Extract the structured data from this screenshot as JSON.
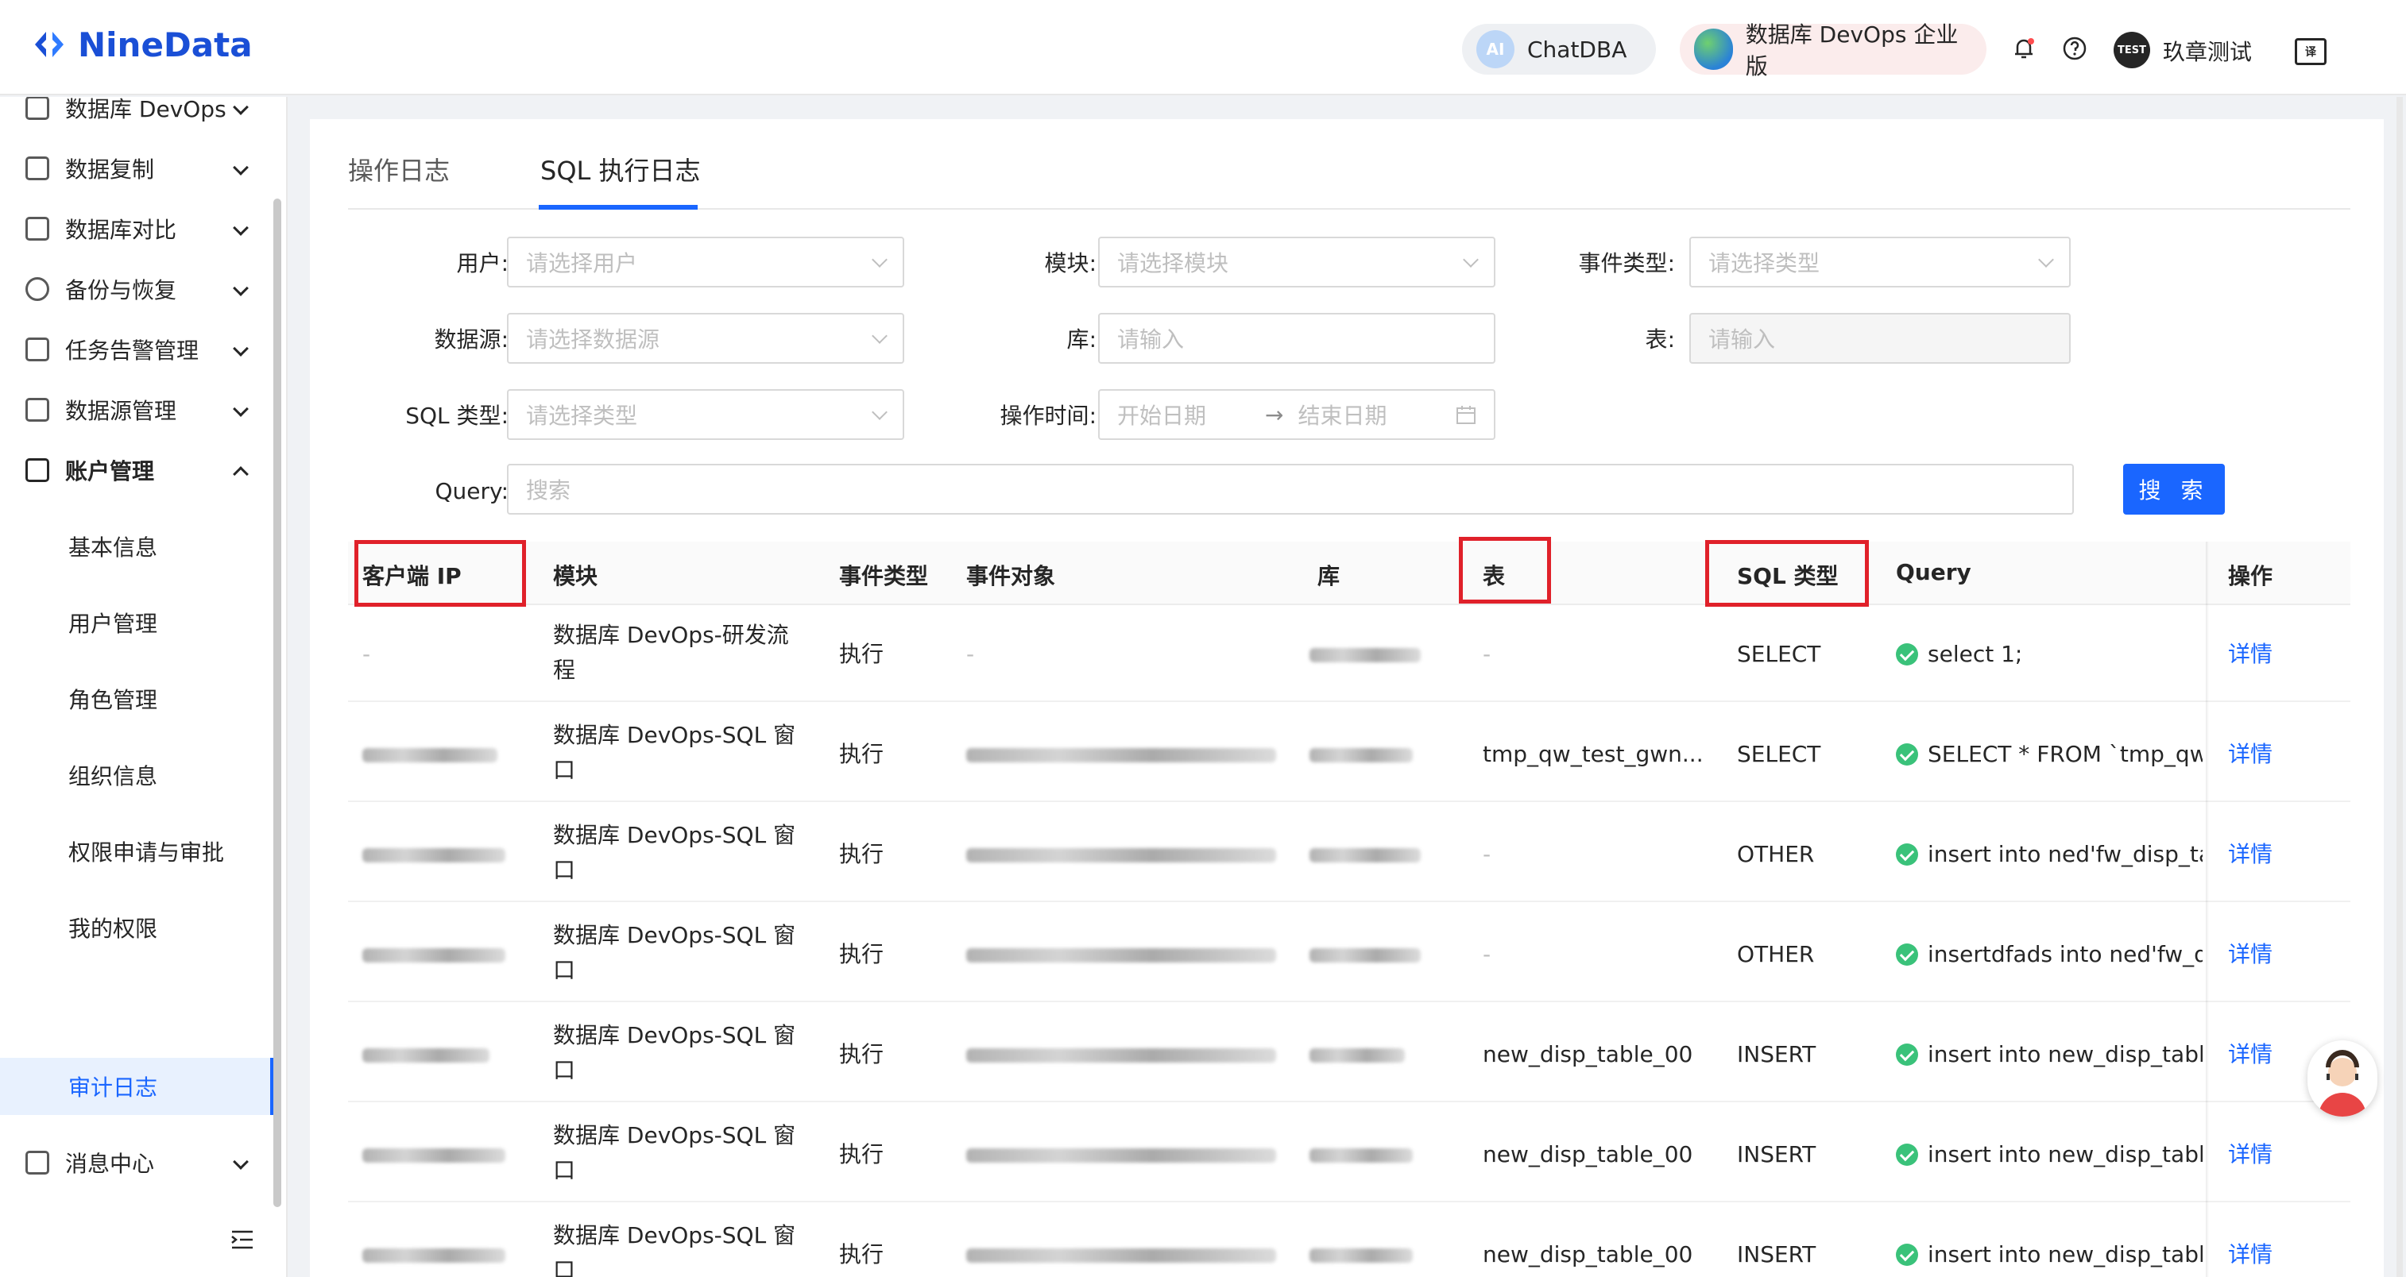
{
  "header": {
    "logo": "NineData",
    "chatdba": {
      "badge": "AI",
      "label": "ChatDBA"
    },
    "edition": "数据库 DevOps 企业版",
    "avatar_text": "TEST",
    "username": "玖章测试",
    "lang_icon": "译"
  },
  "sidebar": {
    "items": [
      {
        "label": "数据库 DevOps",
        "icon": "monitor-icon"
      },
      {
        "label": "数据复制",
        "icon": "replication-icon"
      },
      {
        "label": "数据库对比",
        "icon": "compare-icon"
      },
      {
        "label": "备份与恢复",
        "icon": "cloud-icon"
      },
      {
        "label": "任务告警管理",
        "icon": "alarm-icon"
      },
      {
        "label": "数据源管理",
        "icon": "datasource-icon"
      },
      {
        "label": "账户管理",
        "icon": "account-icon"
      },
      {
        "label": "消息中心",
        "icon": "mail-icon"
      }
    ],
    "subitems": [
      "基本信息",
      "用户管理",
      "角色管理",
      "组织信息",
      "权限申请与审批",
      "我的权限",
      "审计日志"
    ],
    "active": "审计日志"
  },
  "tabs": [
    "操作日志",
    "SQL 执行日志"
  ],
  "filters": {
    "user": {
      "label": "用户",
      "placeholder": "请选择用户"
    },
    "module": {
      "label": "模块",
      "placeholder": "请选择模块"
    },
    "event_type": {
      "label": "事件类型",
      "placeholder": "请选择类型"
    },
    "datasource": {
      "label": "数据源",
      "placeholder": "请选择数据源"
    },
    "db": {
      "label": "库",
      "placeholder": "请输入"
    },
    "table": {
      "label": "表",
      "placeholder": "请输入"
    },
    "sql_type": {
      "label": "SQL 类型",
      "placeholder": "请选择类型"
    },
    "op_time": {
      "label": "操作时间",
      "start": "开始日期",
      "end": "结束日期",
      "sep": "→"
    },
    "query": {
      "label": "Query",
      "placeholder": "搜索"
    },
    "search_button": "搜 索"
  },
  "table": {
    "columns": [
      "客户端 IP",
      "模块",
      "事件类型",
      "事件对象",
      "库",
      "表",
      "SQL 类型",
      "Query",
      "操作"
    ],
    "rows": [
      {
        "ip": "-",
        "module": [
          "数据库 DevOps-研发流",
          "程"
        ],
        "event": "执行",
        "object": "-",
        "table": "-",
        "sql_type": "SELECT",
        "query": "select 1;",
        "action": "详情"
      },
      {
        "ip": "",
        "module": [
          "数据库 DevOps-SQL 窗",
          "口"
        ],
        "event": "执行",
        "object": "",
        "table": "tmp_qw_test_gwn...",
        "sql_type": "SELECT",
        "query": "SELECT * FROM `tmp_qw_",
        "action": "详情"
      },
      {
        "ip": "",
        "module": [
          "数据库 DevOps-SQL 窗",
          "口"
        ],
        "event": "执行",
        "object": "",
        "table": "-",
        "sql_type": "OTHER",
        "query": "insert into ned'fw_disp_tab",
        "action": "详情"
      },
      {
        "ip": "",
        "module": [
          "数据库 DevOps-SQL 窗",
          "口"
        ],
        "event": "执行",
        "object": "",
        "table": "-",
        "sql_type": "OTHER",
        "query": "insertdfads into ned'fw_dis",
        "action": "详情"
      },
      {
        "ip": "",
        "module": [
          "数据库 DevOps-SQL 窗",
          "口"
        ],
        "event": "执行",
        "object": "",
        "table": "new_disp_table_00",
        "sql_type": "INSERT",
        "query": "insert into new_disp_table_",
        "action": "详情"
      },
      {
        "ip": "",
        "module": [
          "数据库 DevOps-SQL 窗",
          "口"
        ],
        "event": "执行",
        "object": "",
        "table": "new_disp_table_00",
        "sql_type": "INSERT",
        "query": "insert into new_disp_table_",
        "action": "详情"
      },
      {
        "ip": "",
        "module": [
          "数据库 DevOps-SQL 窗",
          "口"
        ],
        "event": "执行",
        "object": "",
        "table": "new_disp_table_00",
        "sql_type": "INSERT",
        "query": "insert into new_disp_table_",
        "action": "详情"
      }
    ]
  },
  "colors": {
    "accent": "#1a66ff",
    "highlight": "#e0212a",
    "success": "#3ac27a"
  }
}
